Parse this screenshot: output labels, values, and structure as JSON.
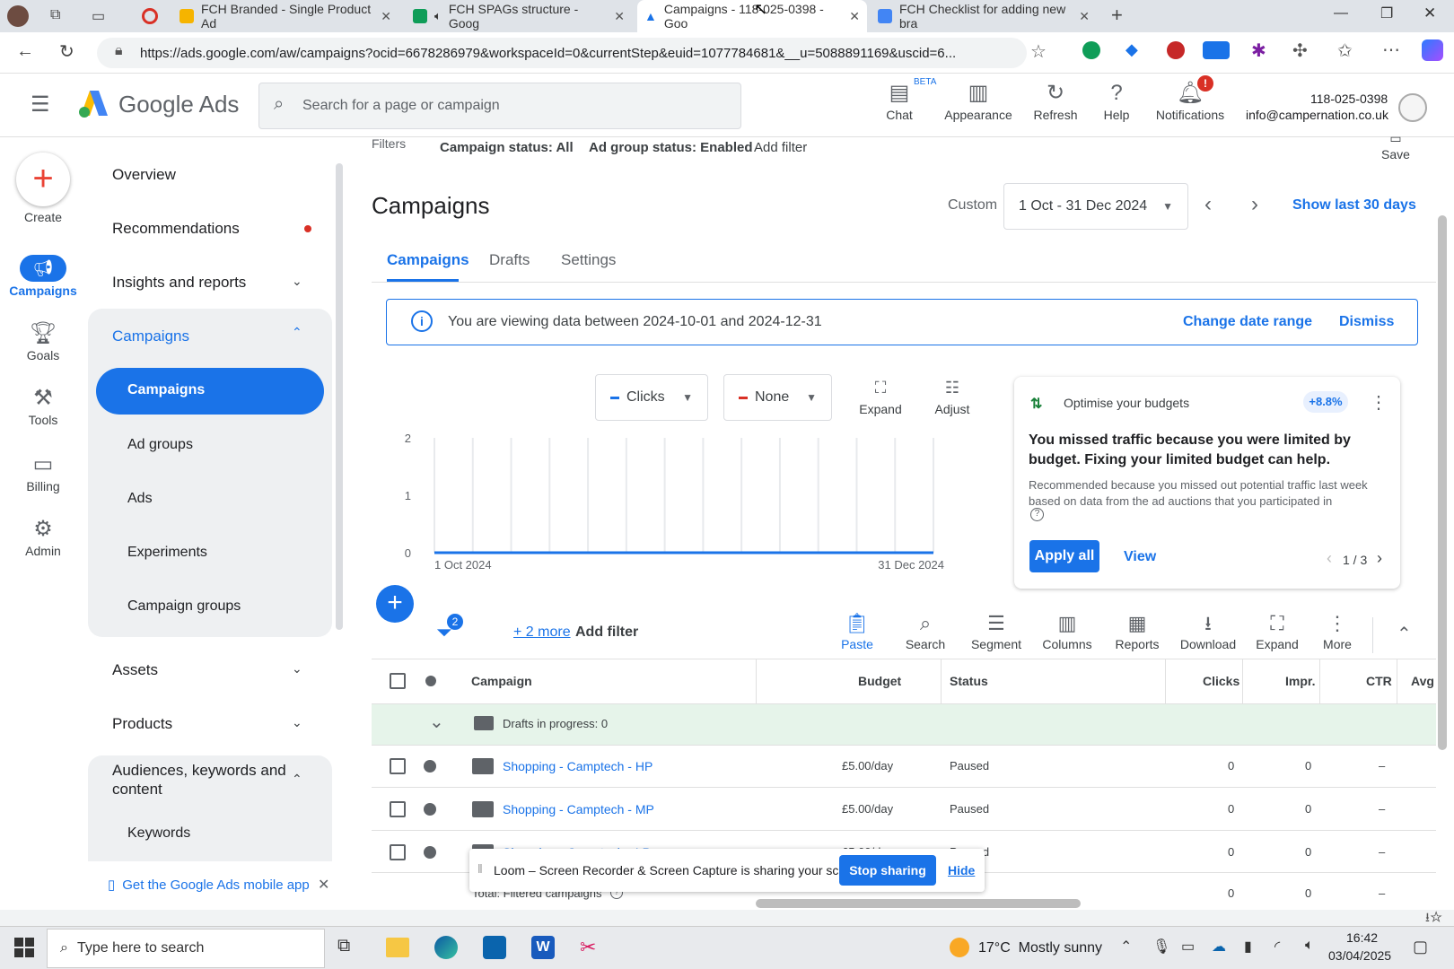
{
  "browser": {
    "tabs": [
      {
        "title": "FCH Branded - Single Product Ad",
        "color": "#f6b400"
      },
      {
        "title": "FCH SPAGs structure - Goog",
        "color": "#0f9d58"
      },
      {
        "title": "Campaigns - 118-025-0398 - Goo",
        "color": "#1a73e8"
      },
      {
        "title": "FCH Checklist for adding new bra",
        "color": "#4285f4"
      }
    ],
    "url": "https://ads.google.com/aw/campaigns?ocid=6678286979&workspaceId=0&currentStep&euid=1077784681&__u=5088891169&uscid=6..."
  },
  "header": {
    "brand": "Google Ads",
    "search_placeholder": "Search for a page or campaign",
    "beta": "BETA",
    "chat": "Chat",
    "appearance": "Appearance",
    "refresh": "Refresh",
    "help": "Help",
    "notifications": "Notifications",
    "account_id": "118-025-0398",
    "account_email": "info@campernation.co.uk"
  },
  "rail": {
    "create": "Create",
    "campaigns": "Campaigns",
    "goals": "Goals",
    "tools": "Tools",
    "billing": "Billing",
    "admin": "Admin"
  },
  "nav": {
    "overview": "Overview",
    "recommendations": "Recommendations",
    "insights": "Insights and reports",
    "campaigns_group": "Campaigns",
    "campaigns": "Campaigns",
    "ad_groups": "Ad groups",
    "ads": "Ads",
    "experiments": "Experiments",
    "campaign_groups": "Campaign groups",
    "assets": "Assets",
    "products": "Products",
    "audiences": "Audiences, keywords and content",
    "keywords": "Keywords",
    "mobile_app": "Get the Google Ads mobile app"
  },
  "filters": {
    "label": "Filters",
    "campaign_status": "Campaign status: All",
    "ad_group_status": "Ad group status: Enabled",
    "add_filter": "Add filter",
    "save": "Save"
  },
  "main": {
    "title": "Campaigns",
    "date_label": "Custom",
    "date_range": "1 Oct - 31 Dec 2024",
    "show_last": "Show last 30 days",
    "tabs": [
      "Campaigns",
      "Drafts",
      "Settings"
    ]
  },
  "banner": {
    "text": "You are viewing data between 2024-10-01 and 2024-12-31",
    "change": "Change date range",
    "dismiss": "Dismiss"
  },
  "chart_controls": {
    "metric1": "Clicks",
    "metric2": "None",
    "expand": "Expand",
    "adjust": "Adjust"
  },
  "chart_data": {
    "type": "line",
    "x": [
      "1 Oct 2024",
      "31 Dec 2024"
    ],
    "series": [
      {
        "name": "Clicks",
        "values": [
          0,
          0
        ]
      }
    ],
    "y_ticks": [
      "2",
      "1",
      "0"
    ],
    "ylim": [
      0,
      2
    ],
    "x_tick_labels": [
      "1 Oct 2024",
      "31 Dec 2024"
    ]
  },
  "recommendation": {
    "title": "Optimise your budgets",
    "badge": "+8.8%",
    "headline": "You missed traffic because you were limited by budget. Fixing your limited budget can help.",
    "body": "Recommended because you missed out potential traffic last week based on data from the ad auctions that you participated in",
    "apply": "Apply all",
    "view": "View",
    "pager": "1 / 3"
  },
  "table_toolbar": {
    "filter_count": "2",
    "more": "+ 2 more",
    "add_filter": "Add filter",
    "paste": "Paste",
    "search": "Search",
    "segment": "Segment",
    "columns": "Columns",
    "reports": "Reports",
    "download": "Download",
    "expand": "Expand",
    "more_btn": "More"
  },
  "table": {
    "headers": {
      "campaign": "Campaign",
      "budget": "Budget",
      "status": "Status",
      "clicks": "Clicks",
      "impr": "Impr.",
      "ctr": "CTR",
      "avg": "Avg"
    },
    "drafts": "Drafts in progress: 0",
    "rows": [
      {
        "name": "Shopping - Camptech - HP",
        "budget": "£5.00/day",
        "status": "Paused",
        "clicks": "0",
        "impr": "0",
        "ctr": "–"
      },
      {
        "name": "Shopping - Camptech - MP",
        "budget": "£5.00/day",
        "status": "Paused",
        "clicks": "0",
        "impr": "0",
        "ctr": "–"
      },
      {
        "name": "Shopping - Camptech - LP",
        "budget": "£5.00/day",
        "status": "Paused",
        "clicks": "0",
        "impr": "0",
        "ctr": "–"
      }
    ],
    "total": "Total: Filtered campaigns",
    "total_clicks": "0",
    "total_impr": "0",
    "total_ctr": "–"
  },
  "loom": {
    "text": "Loom – Screen Recorder & Screen Capture is sharing your screen.",
    "stop": "Stop sharing",
    "hide": "Hide"
  },
  "taskbar": {
    "search_placeholder": "Type here to search",
    "weather": "17°C  Mostly sunny",
    "time": "16:42",
    "date": "03/04/2025"
  }
}
